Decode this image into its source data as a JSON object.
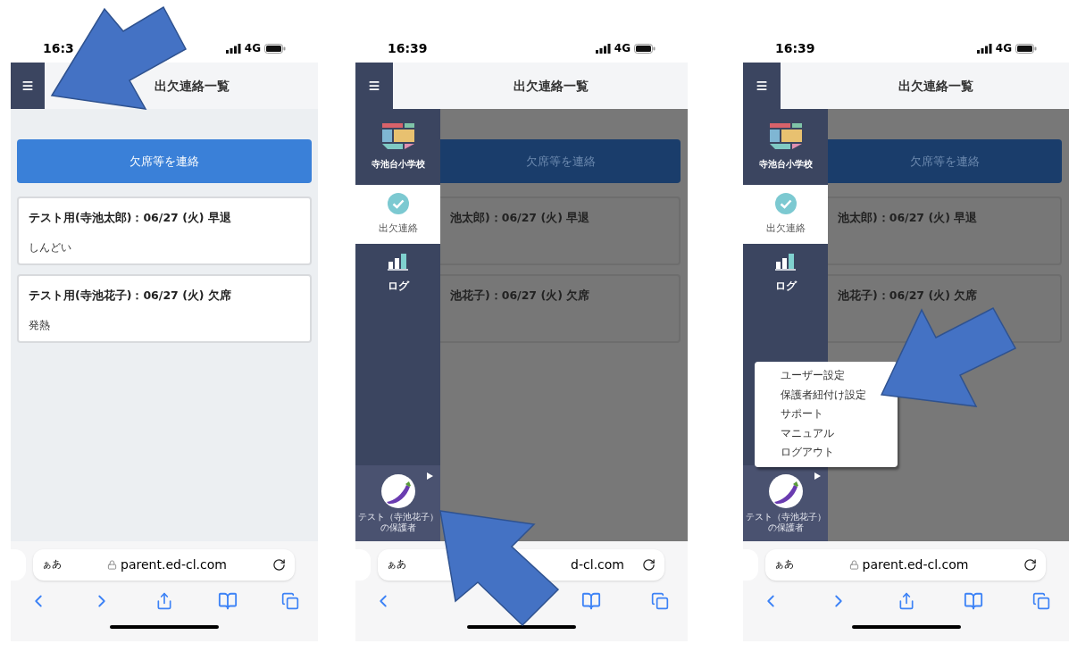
{
  "screens": [
    {
      "status": {
        "time": "16:3",
        "network": "4G"
      },
      "title": "出欠連絡一覧",
      "overlay": false,
      "action_button": "欠席等を連絡",
      "cards": [
        {
          "title": "テスト用(寺池太郎)：06/27 (火) 早退",
          "note": "しんどい"
        },
        {
          "title": "テスト用(寺池花子)：06/27 (火) 欠席",
          "note": "発熱"
        }
      ],
      "browser": {
        "text_size": "ぁあ",
        "url": "parent.ed-cl.com",
        "lock": true,
        "buttons": [
          {
            "kind": "back"
          },
          {
            "kind": "forward"
          },
          {
            "kind": "share"
          },
          {
            "kind": "bookmarks"
          },
          {
            "kind": "tabs"
          }
        ]
      }
    },
    {
      "status": {
        "time": "16:39",
        "network": "4G"
      },
      "title": "出欠連絡一覧",
      "overlay": true,
      "action_button": "欠席等を連絡",
      "cards": [
        {
          "title": "池太郎)：06/27 (火) 早退"
        },
        {
          "title": "池花子)：06/27 (火) 欠席"
        }
      ],
      "drawer": {
        "school": "寺池台小学校",
        "items": [
          {
            "kind": "attendance",
            "label": "出欠連絡",
            "selected": true
          },
          {
            "kind": "log",
            "label": "ログ",
            "selected": false
          }
        ],
        "user": {
          "name": "テスト（寺池花子）",
          "role": "の保護者"
        }
      },
      "browser": {
        "text_size": "ぁあ",
        "url": "d-cl.com",
        "lock": false,
        "buttons": [
          {
            "kind": "back"
          },
          {
            "kind": "none"
          },
          {
            "kind": "none"
          },
          {
            "kind": "bookmarks"
          },
          {
            "kind": "tabs"
          }
        ]
      }
    },
    {
      "status": {
        "time": "16:39",
        "network": "4G"
      },
      "title": "出欠連絡一覧",
      "overlay": true,
      "action_button": "欠席等を連絡",
      "cards": [
        {
          "title": "池太郎)：06/27 (火) 早退"
        },
        {
          "title": "池花子)：06/27 (火) 欠席"
        }
      ],
      "drawer": {
        "school": "寺池台小学校",
        "items": [
          {
            "kind": "attendance",
            "label": "出欠連絡",
            "selected": true
          },
          {
            "kind": "log",
            "label": "ログ",
            "selected": false
          }
        ],
        "user": {
          "name": "テスト（寺池花子）",
          "role": "の保護者"
        }
      },
      "menu": [
        "ユーザー設定",
        "保護者紐付け設定",
        "サポート",
        "マニュアル",
        "ログアウト"
      ],
      "browser": {
        "text_size": "ぁあ",
        "url": "parent.ed-cl.com",
        "lock": true,
        "buttons": [
          {
            "kind": "back"
          },
          {
            "kind": "forward"
          },
          {
            "kind": "share"
          },
          {
            "kind": "bookmarks"
          },
          {
            "kind": "tabs"
          }
        ]
      }
    }
  ]
}
